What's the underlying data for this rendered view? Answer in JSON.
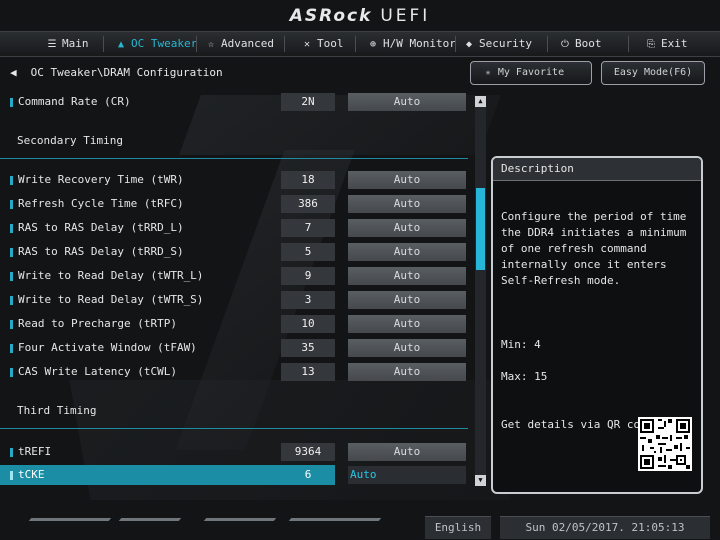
{
  "header": {
    "brand": "ASRock",
    "product": "UEFI"
  },
  "nav": {
    "tabs": [
      {
        "label": "Main",
        "icon": "list-icon",
        "active": false
      },
      {
        "label": "OC Tweaker",
        "icon": "flame-icon",
        "active": true
      },
      {
        "label": "Advanced",
        "icon": "star-icon",
        "active": false
      },
      {
        "label": "Tool",
        "icon": "wrench-icon",
        "active": false
      },
      {
        "label": "H/W Monitor",
        "icon": "gauge-icon",
        "active": false
      },
      {
        "label": "Security",
        "icon": "shield-icon",
        "active": false
      },
      {
        "label": "Boot",
        "icon": "power-icon",
        "active": false
      },
      {
        "label": "Exit",
        "icon": "exit-icon",
        "active": false
      }
    ]
  },
  "breadcrumb": "OC Tweaker\\DRAM Configuration",
  "buttons": {
    "favorite": "My Favorite",
    "easy_mode": "Easy Mode(F6)"
  },
  "rows_top": [
    {
      "label": "Command Rate (CR)",
      "value": "2N",
      "option": "Auto"
    }
  ],
  "sections": {
    "secondary": "Secondary Timing",
    "third": "Third Timing"
  },
  "secondary_rows": [
    {
      "label": "Write Recovery Time (tWR)",
      "value": "18",
      "option": "Auto"
    },
    {
      "label": "Refresh Cycle Time (tRFC)",
      "value": "386",
      "option": "Auto"
    },
    {
      "label": "RAS to RAS Delay (tRRD_L)",
      "value": "7",
      "option": "Auto"
    },
    {
      "label": "RAS to RAS Delay (tRRD_S)",
      "value": "5",
      "option": "Auto"
    },
    {
      "label": "Write to Read Delay (tWTR_L)",
      "value": "9",
      "option": "Auto"
    },
    {
      "label": "Write to Read Delay (tWTR_S)",
      "value": "3",
      "option": "Auto"
    },
    {
      "label": "Read to Precharge (tRTP)",
      "value": "10",
      "option": "Auto"
    },
    {
      "label": "Four Activate Window (tFAW)",
      "value": "35",
      "option": "Auto"
    },
    {
      "label": "CAS Write Latency (tCWL)",
      "value": "13",
      "option": "Auto"
    }
  ],
  "third_rows": [
    {
      "label": "tREFI",
      "value": "9364",
      "option": "Auto",
      "selected": false
    },
    {
      "label": "tCKE",
      "value": "6",
      "option": "Auto",
      "selected": true
    }
  ],
  "description": {
    "title": "Description",
    "text": "Configure the period of time the DDR4 initiates a minimum of one refresh command internally once it enters Self-Refresh mode.",
    "min": "Min: 4",
    "max": "Max: 15",
    "qr_label": "Get details via QR code"
  },
  "footer": {
    "language": "English",
    "datetime": "Sun 02/05/2017. 21:05:13"
  },
  "colors": {
    "accent": "#29b6d3",
    "selected_row": "#1b8ea6"
  }
}
